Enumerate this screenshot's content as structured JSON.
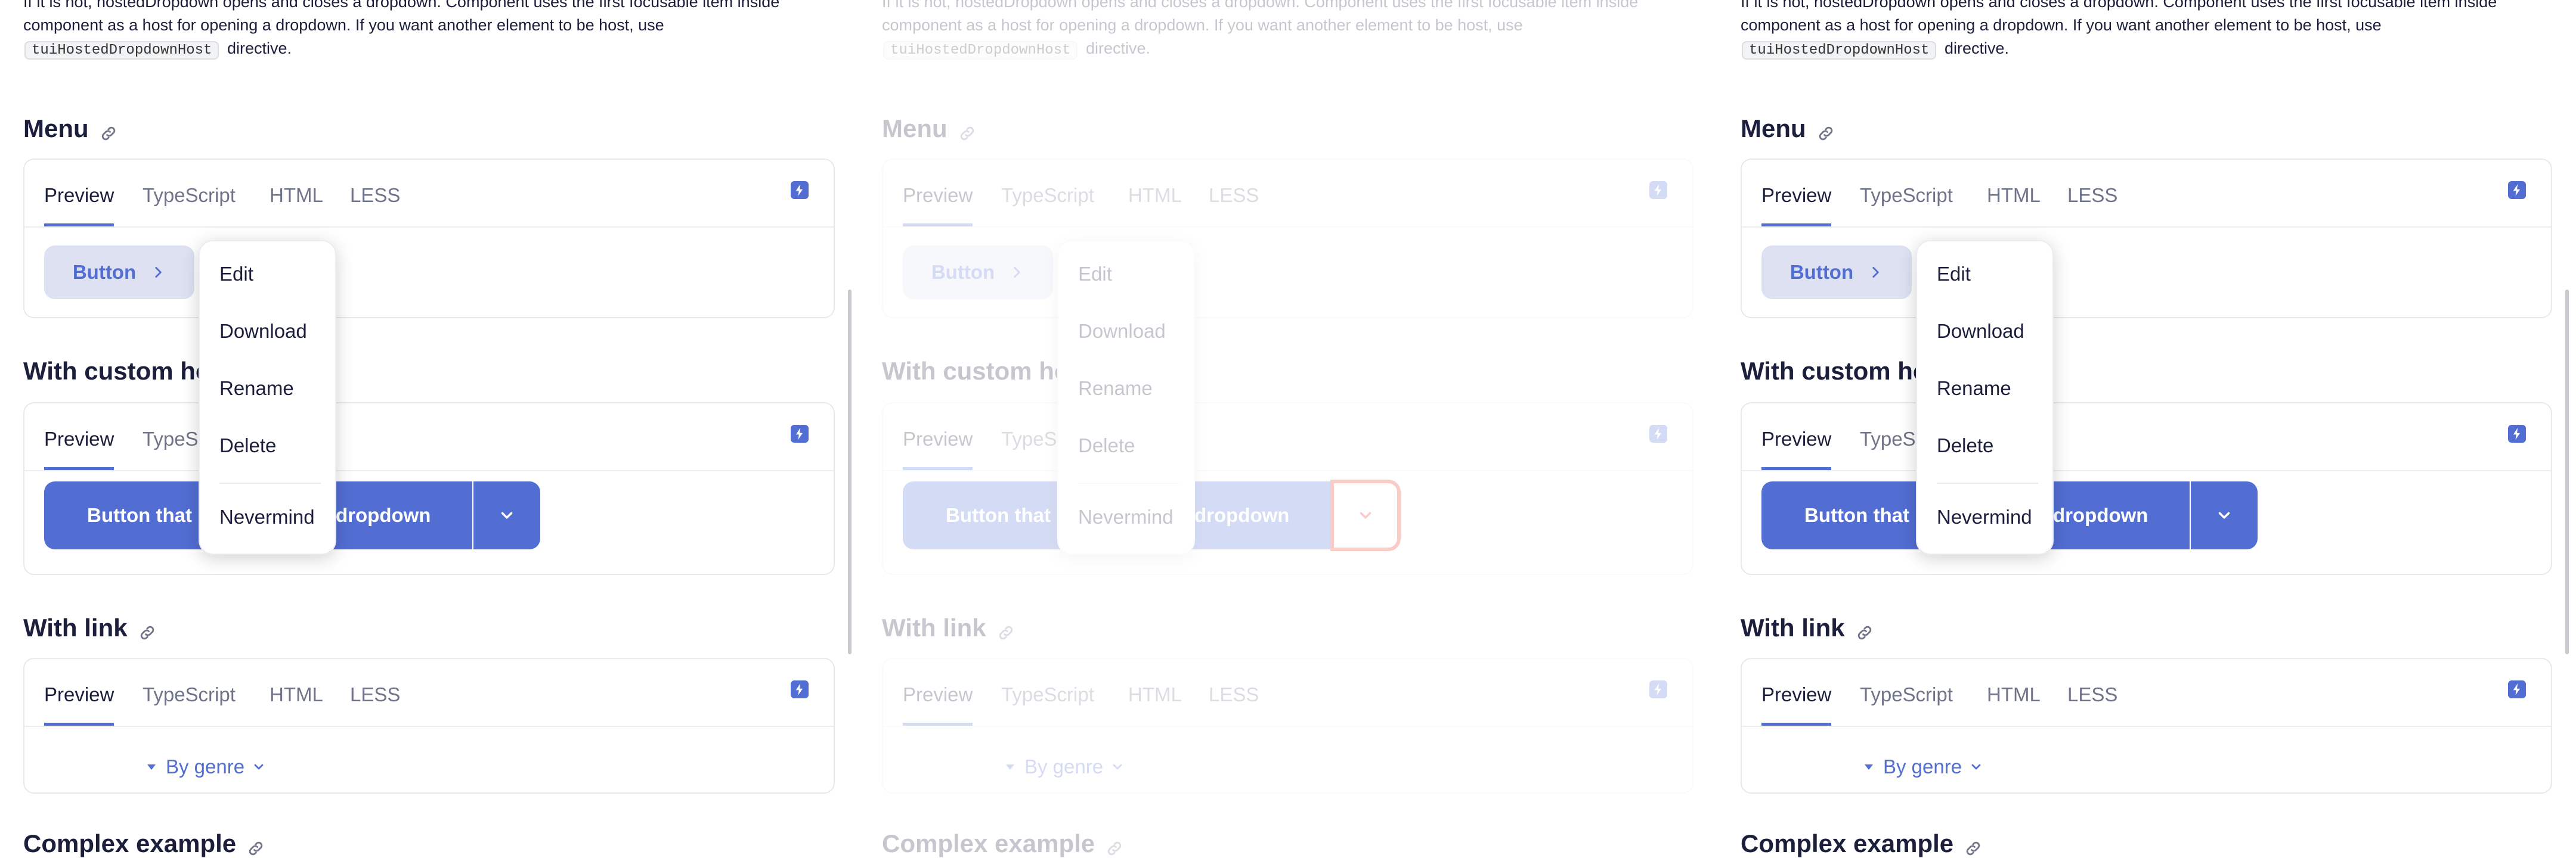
{
  "intro": {
    "line1": "If it is not, hostedDropdown opens and closes a dropdown. Component uses the first focusable item inside",
    "line2": "component as a host for opening a dropdown. If you want another element to be host, use",
    "code": "tuiHostedDropdownHost",
    "line3_suffix": "directive."
  },
  "tabs": {
    "preview": "Preview",
    "typescript": "TypeScript",
    "html": "HTML",
    "less": "LESS"
  },
  "sections": {
    "menu": {
      "title": "Menu",
      "button_label": "Button"
    },
    "custom_host": {
      "title": "With custom host",
      "button_label_left": "Button that",
      "button_label_right": "dropdown"
    },
    "with_link": {
      "title": "With link",
      "link_label": "By genre"
    },
    "complex": {
      "title": "Complex example"
    }
  },
  "dropdown": {
    "items": [
      "Edit",
      "Download",
      "Rename",
      "Delete"
    ],
    "footer_item": "Nevermind"
  },
  "colors": {
    "accent": "#526ed3",
    "secondary_bg": "#dde1f2",
    "focus_outline": "#e8311c",
    "text": "#1b1f3b",
    "muted": "#707489"
  },
  "icons": {
    "link": "link-icon",
    "bolt": "bolt-icon",
    "chevron_right": "chevron-right-icon",
    "chevron_down": "chevron-down-icon",
    "caret_down": "caret-down-icon"
  }
}
